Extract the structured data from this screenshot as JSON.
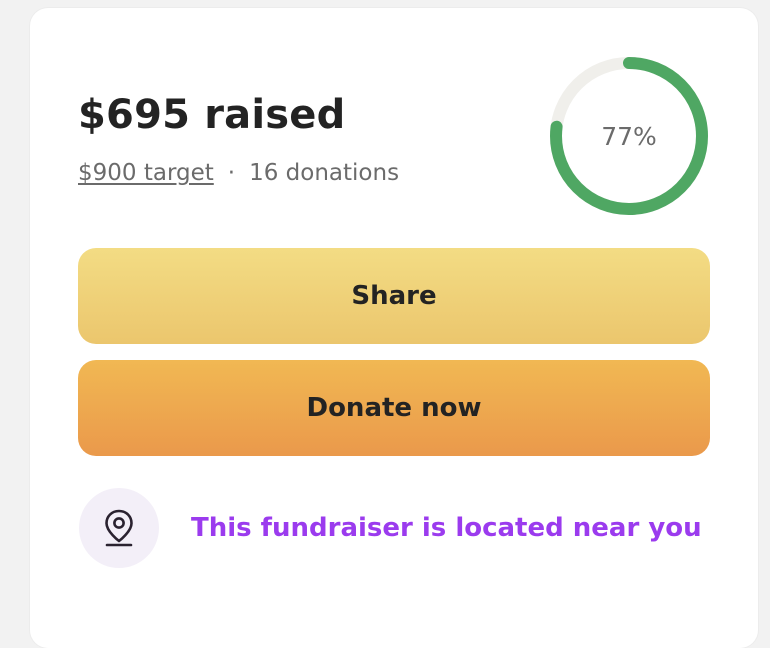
{
  "fundraiser": {
    "raised_label": "$695 raised",
    "target_label": "$900 target",
    "separator": "·",
    "donations_label": "16 donations",
    "progress_label": "77%",
    "progress_fraction": 0.77
  },
  "actions": {
    "share_label": "Share",
    "donate_label": "Donate now"
  },
  "location": {
    "icon": "map-pin-icon",
    "text": "This fundraiser is located near you"
  },
  "colors": {
    "progress": "#4fa763",
    "progress_track": "#f0efeb",
    "share_button": "#f0d27a",
    "donate_button": "#eeaa4f",
    "location_text": "#9b3bee",
    "location_badge": "#f3eff8"
  }
}
